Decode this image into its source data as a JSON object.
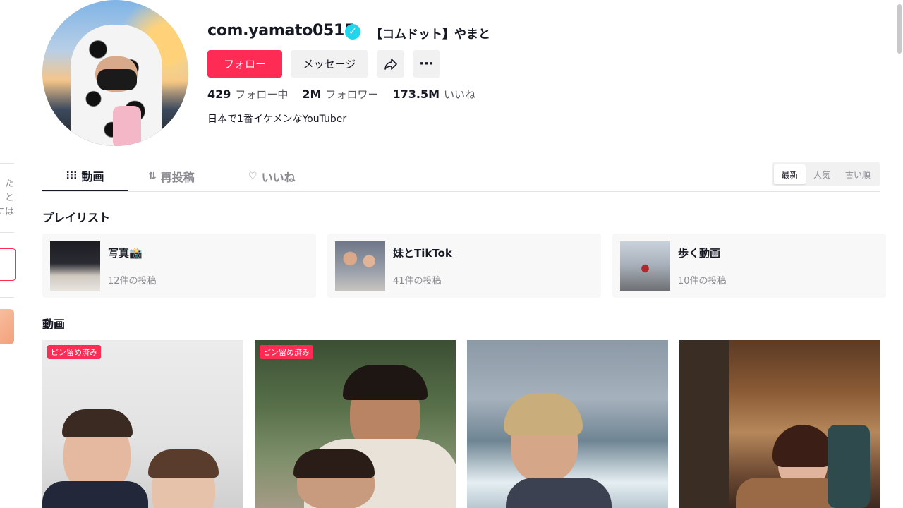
{
  "profile": {
    "username": "com.yamato0515",
    "nickname": "【コムドット】やまと",
    "bio": "日本で1番イケメンなYouTuber",
    "follow_label": "フォロー",
    "message_label": "メッセージ",
    "stats": {
      "following": "429",
      "following_label": "フォロー中",
      "followers": "2M",
      "followers_label": "フォロワー",
      "likes": "173.5M",
      "likes_label": "いいね"
    }
  },
  "tabs": [
    {
      "label": "動画",
      "icon": "grid-icon",
      "active": true
    },
    {
      "label": "再投稿",
      "icon": "repost-icon"
    },
    {
      "label": "いいね",
      "icon": "heart-lock-icon"
    }
  ],
  "sort": {
    "options": [
      "最新",
      "人気",
      "古い順"
    ],
    "selected": "最新"
  },
  "playlists_title": "プレイリスト",
  "playlists": [
    {
      "name": "写真📸",
      "count": "12件の投稿"
    },
    {
      "name": "妹とTikTok",
      "count": "41件の投稿"
    },
    {
      "name": "歩く動画",
      "count": "10件の投稿"
    }
  ],
  "videos_title": "動画",
  "videos": [
    {
      "badge": "ピン留め済み"
    },
    {
      "badge": "ピン留め済み"
    },
    {
      "badge": ""
    },
    {
      "badge": ""
    }
  ],
  "sidebar_fragments": [
    "た",
    "と",
    "には"
  ],
  "colors": {
    "accent": "#fe2c55",
    "verified": "#20d5ec",
    "text": "#161823",
    "muted": "#8a8b91"
  }
}
